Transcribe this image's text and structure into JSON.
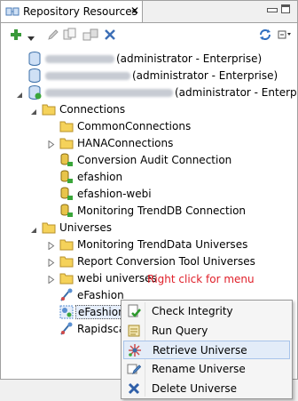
{
  "tab": {
    "title": "Repository Resources",
    "close": "✕"
  },
  "tree": {
    "servers": [
      {
        "suffix": "(administrator - Enterprise)"
      },
      {
        "suffix": "(administrator - Enterprise)"
      },
      {
        "suffix": "(administrator - Enterprise)"
      }
    ],
    "connections": {
      "label": "Connections",
      "items": [
        "CommonConnections",
        "HANAConnections",
        "Conversion Audit Connection",
        "efashion",
        "efashion-webi",
        "Monitoring TrendDB Connection"
      ]
    },
    "universes": {
      "label": "Universes",
      "items": [
        "Monitoring TrendData Universes",
        "Report Conversion Tool Universes",
        "webi universes",
        "eFashion",
        "eFashion.unx",
        "Rapidsca"
      ]
    }
  },
  "annotation": "Right click for menu",
  "context_menu": {
    "items": [
      {
        "label": "Check Integrity",
        "icon": "check-integrity-icon"
      },
      {
        "label": "Run Query",
        "icon": "run-query-icon"
      },
      {
        "label": "Retrieve Universe",
        "icon": "retrieve-universe-icon",
        "highlighted": true
      },
      {
        "label": "Rename Universe",
        "icon": "rename-icon"
      },
      {
        "label": "Delete Universe",
        "icon": "delete-icon"
      }
    ]
  },
  "colors": {
    "folder": "#f5d25a",
    "annotation": "#e0202a",
    "highlight": "#e3ecf8"
  }
}
